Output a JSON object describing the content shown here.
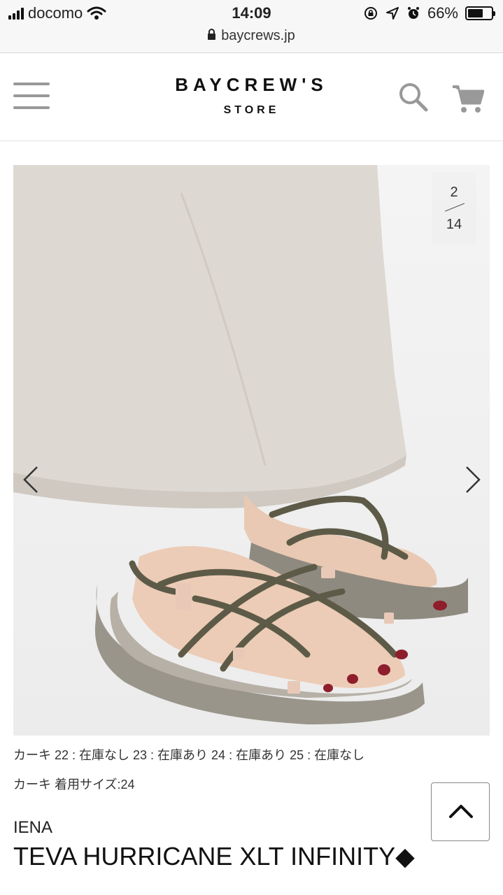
{
  "status_bar": {
    "carrier": "docomo",
    "time": "14:09",
    "battery_percent": "66%",
    "battery_level": 0.66,
    "url": "baycrews.jp",
    "icons": [
      "signal-icon",
      "wifi-icon",
      "lock-rotation-icon",
      "location-icon",
      "alarm-icon",
      "battery-icon",
      "lock-icon"
    ]
  },
  "header": {
    "logo_main": "BAYCREW'S",
    "logo_sub": "STORE",
    "icons": [
      "hamburger-menu-icon",
      "search-icon",
      "cart-icon"
    ]
  },
  "gallery": {
    "current": "2",
    "total": "14",
    "icons": [
      "chevron-left-icon",
      "chevron-right-icon"
    ]
  },
  "product": {
    "stock_line": "カーキ 22 : 在庫なし 23 : 在庫あり 24 : 在庫あり 25 : 在庫なし",
    "worn_size_line": "カーキ 着用サイズ:24",
    "brand": "IENA",
    "name": "TEVA HURRICANE XLT INFINITY◆"
  },
  "colors": {
    "background": "#ffffff",
    "status_bar": "#f7f7f7",
    "icon_gray": "#999999",
    "text": "#222222"
  }
}
